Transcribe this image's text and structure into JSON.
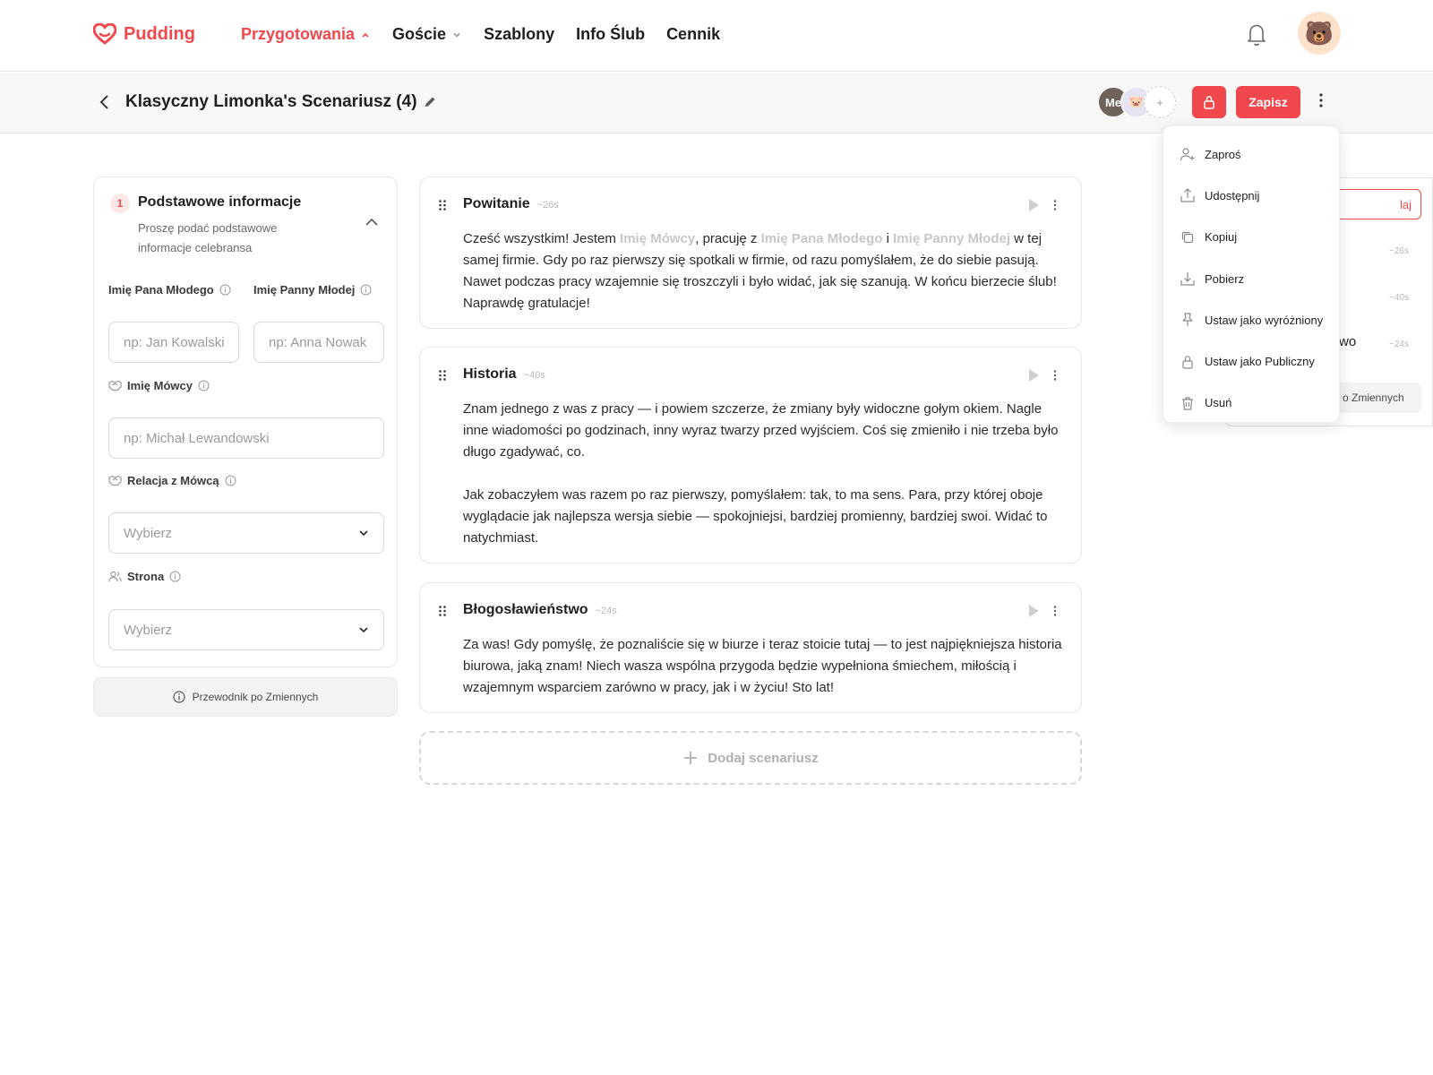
{
  "brand": {
    "name": "Pudding",
    "accent": "#f0484d"
  },
  "nav": {
    "items": [
      {
        "label": "Przygotowania"
      },
      {
        "label": "Goście"
      },
      {
        "label": "Szablony"
      },
      {
        "label": "Info Ślub"
      },
      {
        "label": "Cennik"
      }
    ]
  },
  "header": {
    "title": "Klasyczny Limonka's Scenariusz (4)",
    "me_label": "Me",
    "add_label": "+",
    "save_label": "Zapisz"
  },
  "left": {
    "step": "1",
    "title": "Podstawowe informacje",
    "subtitle": "Proszę podać podstawowe informacje celebransa",
    "groom_label": "Imię Pana Młodego",
    "groom_placeholder": "np: Jan Kowalski",
    "bride_label": "Imię Panny Młodej",
    "bride_placeholder": "np: Anna Nowak",
    "speaker_label": "Imię Mówcy",
    "speaker_placeholder": "np: Michał Lewandowski",
    "relation_label": "Relacja z Mówcą",
    "relation_value": "Wybierz",
    "side_label": "Strona",
    "side_value": "Wybierz",
    "guide_label": "Przewodnik po Zmiennych"
  },
  "cards": [
    {
      "title": "Powitanie",
      "duration": "~26s",
      "t1": "Cześć wszystkim! Jestem ",
      "v1": "Imię Mówcy",
      "t2": ", pracuję z ",
      "v2": "Imię Pana Młodego",
      "t3": " i ",
      "v3": "Imię Panny Młodej",
      "t4": " w tej samej firmie. Gdy po raz pierwszy się spotkali w firmie, od razu pomyślałem, że do siebie pasują. Nawet podczas pracy wzajemnie się troszczyli i było widać, jak się szanują. W końcu bierzecie ślub! Naprawdę gratulacje!"
    },
    {
      "title": "Historia",
      "duration": "~40s",
      "p1": "Znam jednego z was z pracy — i powiem szczerze, że zmiany były widoczne gołym okiem. Nagle inne wiadomości po godzinach, inny wyraz twarzy przed wyjściem. Coś się zmieniło i nie trzeba było długo zgadywać, co.",
      "p2": "Jak zobaczyłem was razem po raz pierwszy, pomyślałem: tak, to ma sens. Para, przy której oboje wyglądacie jak najlepsza wersja siebie — spokojniejsi, bardziej promienny, bardziej swoi. Widać to natychmiast."
    },
    {
      "title": "Błogosławieństwo",
      "duration": "~24s",
      "p1": "Za was! Gdy pomyślę, że poznaliście się w biurze i teraz stoicie tutaj — to jest najpiękniejsza historia biurowa, jaką znam! Niech wasza wspólna przygoda będzie wypełniona śmiechem, miłością i wzajemnym wsparciem zarówno w pracy, jak i w życiu! Sto lat!"
    }
  ],
  "add_script_label": "Dodaj scenariusz",
  "bg_panel": {
    "btn_fragment": "laj",
    "durations": [
      "~26s",
      "~40s",
      "~24s"
    ],
    "text_fragment": "wo",
    "guide_fragment": "o Zmiennych"
  },
  "menu": {
    "items": [
      {
        "label": "Zaproś",
        "icon": "user-plus-icon"
      },
      {
        "label": "Udostępnij",
        "icon": "share-icon"
      },
      {
        "label": "Kopiuj",
        "icon": "copy-icon"
      },
      {
        "label": "Pobierz",
        "icon": "download-icon"
      },
      {
        "label": "Ustaw jako wyróżniony",
        "icon": "pin-icon"
      },
      {
        "label": "Ustaw jako Publiczny",
        "icon": "lock-icon"
      },
      {
        "label": "Usuń",
        "icon": "trash-icon"
      }
    ]
  }
}
